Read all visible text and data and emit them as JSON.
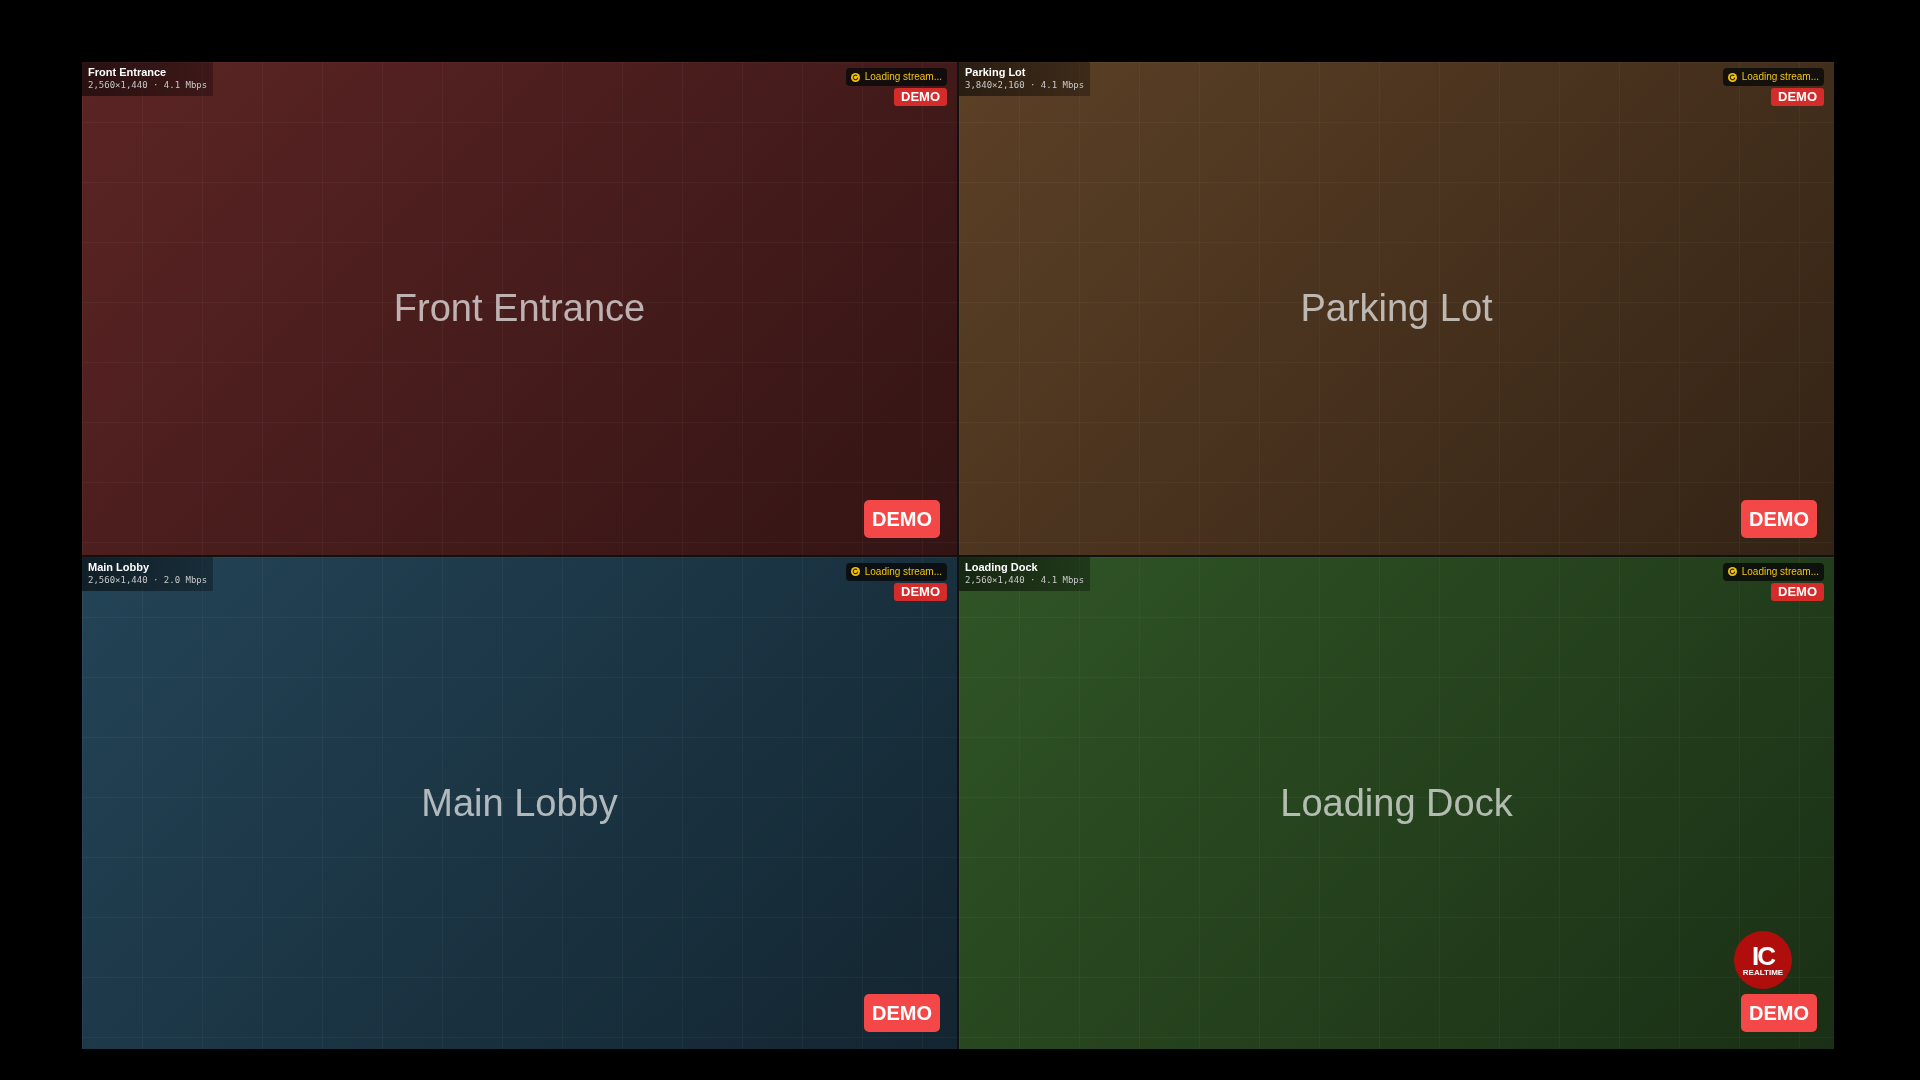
{
  "tiles": [
    {
      "camera": "Front Entrance",
      "specs": "2,560×1,440 · 4.1 Mbps",
      "status": "Loading stream...",
      "top_badge": "DEMO",
      "title": "Front Entrance",
      "demo_button": "DEMO",
      "color": "#5c2424"
    },
    {
      "camera": "Parking Lot",
      "specs": "3,840×2,160 · 4.1 Mbps",
      "status": "Loading stream...",
      "top_badge": "DEMO",
      "title": "Parking Lot",
      "demo_button": "DEMO",
      "color": "#5c4026"
    },
    {
      "camera": "Main Lobby",
      "specs": "2,560×1,440 · 2.0 Mbps",
      "status": "Loading stream...",
      "top_badge": "DEMO",
      "title": "Main Lobby",
      "demo_button": "DEMO",
      "color": "#234457"
    },
    {
      "camera": "Loading Dock",
      "specs": "2,560×1,440 · 4.1 Mbps",
      "status": "Loading stream...",
      "top_badge": "DEMO",
      "title": "Loading Dock",
      "demo_button": "DEMO",
      "color": "#305526",
      "logo": {
        "mark": "IC",
        "sub": "REALTIME"
      }
    }
  ]
}
